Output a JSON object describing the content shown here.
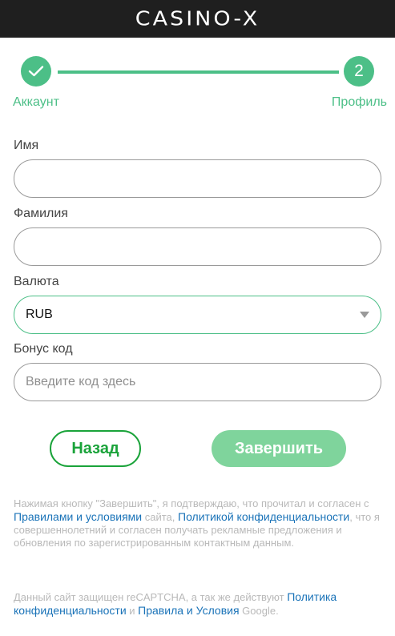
{
  "header": {
    "logo_text": "CASINO-X"
  },
  "stepper": {
    "step1": {
      "icon": "check-icon",
      "label": "Аккаунт"
    },
    "step2": {
      "number": "2",
      "label": "Профиль"
    },
    "accent_color": "#4cbf87"
  },
  "form": {
    "first_name": {
      "label": "Имя",
      "value": ""
    },
    "last_name": {
      "label": "Фамилия",
      "value": ""
    },
    "currency": {
      "label": "Валюта",
      "value": "RUB"
    },
    "bonus": {
      "label": "Бонус код",
      "placeholder": "Введите код здесь"
    }
  },
  "buttons": {
    "back": "Назад",
    "finish": "Завершить"
  },
  "terms": {
    "part1": "Нажимая кнопку \"Завершить\", я подтверждаю, что прочитал и согласен с ",
    "link1": "Правилами и условиями",
    "part2": " сайта, ",
    "link2": "Политикой конфиденциальности",
    "part3": ", что я совершеннолетний и согласен получать рекламные предложения и обновления по зарегистрированным контактным данным."
  },
  "recaptcha": {
    "part1": "Данный сайт защищен reCAPTCHA, а так же действуют ",
    "link1": "Политика конфиденциальности",
    "part2": " и ",
    "link2": "Правила и Условия",
    "part3": " Google."
  }
}
